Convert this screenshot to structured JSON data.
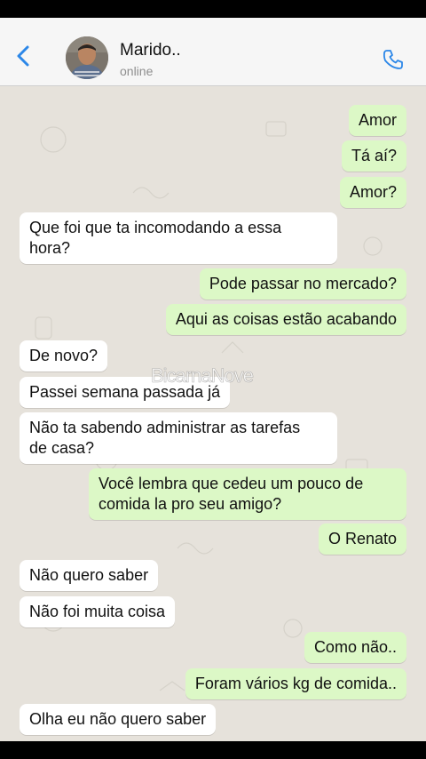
{
  "header": {
    "contact_name": "Marido..",
    "status": "online",
    "back_icon": "chevron-left-icon",
    "call_icon": "phone-icon",
    "accent": "#2c87e8"
  },
  "watermark": "BicarnaNove",
  "messages": [
    {
      "dir": "out",
      "text": "Amor"
    },
    {
      "dir": "out",
      "text": "Tá aí?"
    },
    {
      "dir": "out",
      "text": "Amor?"
    },
    {
      "dir": "in",
      "text": "Que foi que ta incomodando a essa\nhora?"
    },
    {
      "dir": "out",
      "text": "Pode passar no mercado?"
    },
    {
      "dir": "out",
      "text": "Aqui as coisas estão acabando"
    },
    {
      "dir": "in",
      "text": "De novo?"
    },
    {
      "dir": "in",
      "text": "Passei semana passada já"
    },
    {
      "dir": "in",
      "text": "Não ta sabendo administrar as tarefas\nde casa?"
    },
    {
      "dir": "out",
      "text": "Você lembra que cedeu um pouco de\ncomida la pro seu amigo?"
    },
    {
      "dir": "out",
      "text": "O Renato"
    },
    {
      "dir": "in",
      "text": "Não quero saber"
    },
    {
      "dir": "in",
      "text": "Não foi muita coisa"
    },
    {
      "dir": "out",
      "text": "Como não.."
    },
    {
      "dir": "out",
      "text": "Foram vários kg de comida.."
    },
    {
      "dir": "in",
      "text": "Olha eu não quero saber"
    }
  ]
}
